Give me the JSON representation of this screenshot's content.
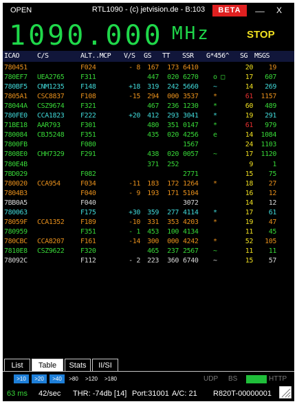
{
  "titlebar": {
    "open": "OPEN",
    "title": "RTL1090 - (c) jetvision.de - B:103",
    "beta": "BETA",
    "minimize": "__",
    "close": "X"
  },
  "frequency": {
    "value": "1090.000",
    "unit": "MHz"
  },
  "stop_label": "STOP",
  "columns": [
    "ICAO",
    "C/S",
    "ALT..MCP",
    "V/S",
    "GS",
    "TT",
    "SSR",
    "G*456^",
    "SG",
    "MSGS"
  ],
  "colors": {
    "orange": "#e8901c",
    "green": "#38d838",
    "cyan": "#40d8d8",
    "white": "#d8d8d8",
    "yellow": "#f0e020",
    "red": "#e83030",
    "blue": "#1e7fd8"
  },
  "rows": [
    {
      "icao": "780451",
      "cs": "",
      "alt": "F024",
      "vs": "- 8",
      "gs": "167",
      "tt": "173",
      "ssr": "6410",
      "flags": "",
      "sg": "20",
      "msgs": "19",
      "color": "orange",
      "sg_color": "yellow"
    },
    {
      "icao": "780EF7",
      "cs": "UEA2765",
      "alt": "F311",
      "vs": "",
      "gs": "447",
      "tt": "020",
      "ssr": "6270",
      "flags": "o  □",
      "sg": "17",
      "msgs": "607",
      "color": "green",
      "sg_color": "yellow"
    },
    {
      "icao": "780BF5",
      "cs": "CNM1235",
      "alt": "F148",
      "vs": "+18",
      "gs": "319",
      "tt": "242",
      "ssr": "5660",
      "flags": "~",
      "sg": "14",
      "msgs": "269",
      "color": "cyan",
      "sg_color": "yellow"
    },
    {
      "icao": "7805A1",
      "cs": "CSC8837",
      "alt": "F108",
      "vs": "-15",
      "gs": "294",
      "tt": "000",
      "ssr": "3537",
      "flags": "*",
      "sg": "61",
      "msgs": "1157",
      "color": "orange",
      "sg_color": "red"
    },
    {
      "icao": "78044A",
      "cs": "CSZ9674",
      "alt": "F321",
      "vs": "",
      "gs": "467",
      "tt": "236",
      "ssr": "1230",
      "flags": "*",
      "sg": "60",
      "msgs": "489",
      "color": "green",
      "sg_color": "yellow"
    },
    {
      "icao": "780FE0",
      "cs": "CCA1823",
      "alt": "F222",
      "vs": "+20",
      "gs": "412",
      "tt": "293",
      "ssr": "3041",
      "flags": "*",
      "sg": "19",
      "msgs": "291",
      "color": "cyan",
      "sg_color": "yellow"
    },
    {
      "icao": "71BE18",
      "cs": "AAR793",
      "alt": "F301",
      "vs": "",
      "gs": "480",
      "tt": "351",
      "ssr": "0147",
      "flags": "*",
      "sg": "61",
      "msgs": "979",
      "color": "green",
      "sg_color": "red"
    },
    {
      "icao": "780084",
      "cs": "CBJ5248",
      "alt": "F351",
      "vs": "",
      "gs": "435",
      "tt": "020",
      "ssr": "4256",
      "flags": "e",
      "sg": "14",
      "msgs": "1084",
      "color": "green",
      "sg_color": "yellow"
    },
    {
      "icao": "7800FB",
      "cs": "",
      "alt": "F080",
      "vs": "",
      "gs": "",
      "tt": "",
      "ssr": "1567",
      "flags": "",
      "sg": "24",
      "msgs": "1103",
      "color": "green",
      "sg_color": "yellow"
    },
    {
      "icao": "7808E0",
      "cs": "CHH7329",
      "alt": "F291",
      "vs": "",
      "gs": "438",
      "tt": "020",
      "ssr": "0057",
      "flags": "~",
      "sg": "17",
      "msgs": "1120",
      "color": "green",
      "sg_color": "yellow"
    },
    {
      "icao": "780E4B",
      "cs": "",
      "alt": "",
      "vs": "",
      "gs": "371",
      "tt": "252",
      "ssr": "",
      "flags": "",
      "sg": "9",
      "msgs": "1",
      "color": "green",
      "sg_color": "yellow"
    },
    {
      "icao": "7BD029",
      "cs": "",
      "alt": "F082",
      "vs": "",
      "gs": "",
      "tt": "",
      "ssr": "2771",
      "flags": "",
      "sg": "15",
      "msgs": "75",
      "color": "green",
      "sg_color": "yellow"
    },
    {
      "icao": "780020",
      "cs": "CCA954",
      "alt": "F034",
      "vs": "-11",
      "gs": "183",
      "tt": "172",
      "ssr": "1264",
      "flags": "*",
      "sg": "18",
      "msgs": "27",
      "color": "orange",
      "sg_color": "yellow"
    },
    {
      "icao": "7804B3",
      "cs": "",
      "alt": "F040",
      "vs": "- 9",
      "gs": "193",
      "tt": "171",
      "ssr": "5104",
      "flags": "",
      "sg": "16",
      "msgs": "12",
      "color": "orange",
      "sg_color": "yellow"
    },
    {
      "icao": "7BB0A5",
      "cs": "",
      "alt": "F040",
      "vs": "",
      "gs": "",
      "tt": "",
      "ssr": "3072",
      "flags": "",
      "sg": "14",
      "msgs": "12",
      "color": "white",
      "sg_color": "yellow"
    },
    {
      "icao": "780063",
      "cs": "",
      "alt": "F175",
      "vs": "+30",
      "gs": "359",
      "tt": "277",
      "ssr": "4114",
      "flags": "*",
      "sg": "17",
      "msgs": "61",
      "color": "cyan",
      "sg_color": "yellow"
    },
    {
      "icao": "78059F",
      "cs": "CCA1352",
      "alt": "F189",
      "vs": "-10",
      "gs": "331",
      "tt": "353",
      "ssr": "4203",
      "flags": "*",
      "sg": "19",
      "msgs": "47",
      "color": "orange",
      "sg_color": "yellow"
    },
    {
      "icao": "780959",
      "cs": "",
      "alt": "F351",
      "vs": "- 1",
      "gs": "453",
      "tt": "100",
      "ssr": "4134",
      "flags": "",
      "sg": "11",
      "msgs": "45",
      "color": "green",
      "sg_color": "yellow"
    },
    {
      "icao": "780CBC",
      "cs": "CCA8207",
      "alt": "F161",
      "vs": "-14",
      "gs": "300",
      "tt": "000",
      "ssr": "4242",
      "flags": "*",
      "sg": "52",
      "msgs": "105",
      "color": "orange",
      "sg_color": "yellow"
    },
    {
      "icao": "7810E8",
      "cs": "CSZ9622",
      "alt": "F320",
      "vs": "",
      "gs": "465",
      "tt": "237",
      "ssr": "2567",
      "flags": "~",
      "sg": "11",
      "msgs": "11",
      "color": "green",
      "sg_color": "yellow"
    },
    {
      "icao": "78092C",
      "cs": "",
      "alt": "F112",
      "vs": "- 2",
      "gs": "223",
      "tt": "360",
      "ssr": "6740",
      "flags": "~",
      "sg": "15",
      "msgs": "57",
      "color": "white",
      "sg_color": "yellow"
    }
  ],
  "tabs": [
    {
      "label": "List",
      "active": false
    },
    {
      "label": "Table",
      "active": true
    },
    {
      "label": "Stats",
      "active": false
    },
    {
      "label": "II/SI",
      "active": false
    }
  ],
  "ranges": [
    {
      "label": ">10",
      "on": true
    },
    {
      "label": ">20",
      "on": true
    },
    {
      "label": ">40",
      "on": true
    },
    {
      "label": ">80",
      "on": false
    },
    {
      "label": ">120",
      "on": false
    },
    {
      "label": ">180",
      "on": false
    }
  ],
  "indicators": {
    "udp": "UDP",
    "bs": "BS",
    "http": "HTTP"
  },
  "status": {
    "time": "63 ms",
    "rate": "42/sec",
    "thr": "THR: -74db [14]",
    "port": "Port:31001",
    "ac": "A/C: 21",
    "device": "R820T-00000001"
  }
}
